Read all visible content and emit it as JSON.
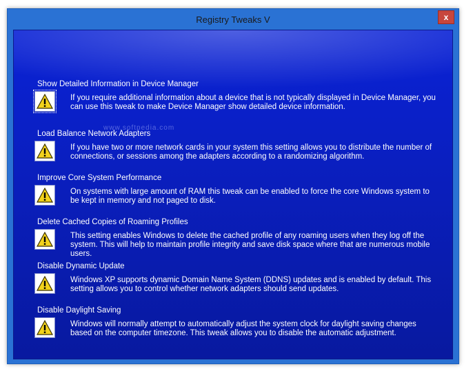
{
  "window": {
    "title": "Registry Tweaks V",
    "close_label": "x"
  },
  "watermark": "www.softpedia.com",
  "tweaks": [
    {
      "title": "Show Detailed Information in Device Manager",
      "description": "If you require additional information about a device that is not typically displayed in Device Manager, you can use this tweak to make Device Manager show detailed device information."
    },
    {
      "title": "Load Balance Network Adapters",
      "description": "If you have two or more network cards in your system this setting allows you to distribute the number of connections, or sessions among the adapters according to a randomizing algorithm."
    },
    {
      "title": "Improve Core System Performance",
      "description": "On systems with large amount of RAM this tweak can be enabled to force the core Windows system to be kept in memory and not paged to disk."
    },
    {
      "title": "Delete Cached Copies of Roaming Profiles",
      "description": "This setting enables Windows to delete the cached profile of any roaming users when they log off the  system. This will help to maintain profile integrity and save disk space where that are numerous mobile users."
    },
    {
      "title": "Disable Dynamic Update",
      "description": "Windows XP supports dynamic Domain Name System (DDNS) updates and is enabled by default. This setting allows you to control whether network adapters should send updates."
    },
    {
      "title": "Disable Daylight Saving",
      "description": "Windows will normally attempt to automatically adjust the system clock for daylight saving changes based on the computer timezone. This tweak allows you to disable the automatic adjustment."
    }
  ],
  "icon": "warning-icon"
}
